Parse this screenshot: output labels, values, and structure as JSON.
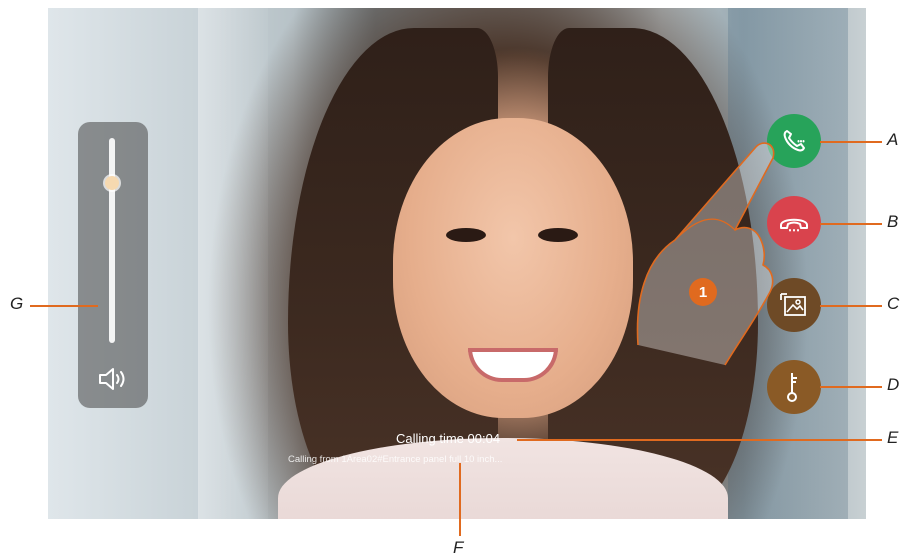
{
  "call": {
    "calling_time": "Calling time 00:04",
    "calling_from": "Calling from 1Area02#Entrance panel full 10 inch..."
  },
  "volume": {
    "level": 0.78,
    "icon": "speaker-icon"
  },
  "buttons": {
    "answer": {
      "icon": "phone-answer-icon",
      "color": "#27a35a"
    },
    "hangup": {
      "icon": "phone-hangup-icon",
      "color": "#d9434d"
    },
    "snapshot": {
      "icon": "image-capture-icon",
      "color": "#6e4a26"
    },
    "door": {
      "icon": "key-icon",
      "color": "#8a5a26"
    }
  },
  "step_badge": "1",
  "callouts": {
    "A": "A",
    "B": "B",
    "C": "C",
    "D": "D",
    "E": "E",
    "F": "F",
    "G": "G"
  },
  "colors": {
    "callout": "#e06a1f"
  }
}
